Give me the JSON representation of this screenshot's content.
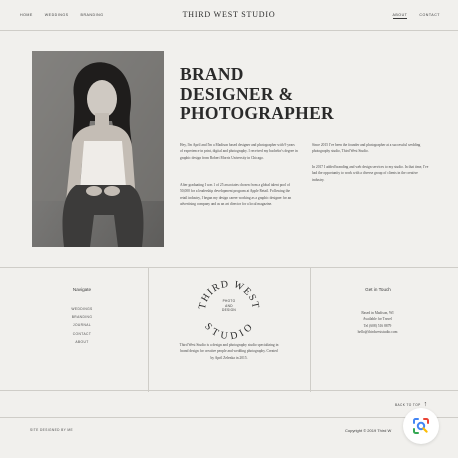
{
  "nav": {
    "left": [
      {
        "label": "Home"
      },
      {
        "label": "Weddings"
      },
      {
        "label": "Branding"
      }
    ],
    "brand": "THIRD WEST STUDIO",
    "right": [
      {
        "label": "About",
        "active": true
      },
      {
        "label": "Contact"
      }
    ]
  },
  "hero": {
    "title_lines": [
      "BRAND",
      "DESIGNER &",
      "PHOTOGRAPHER"
    ],
    "paragraphs": [
      "Hey, I'm April and I'm a Madison based designer and photographer with 9 years of experience in print, digital and photography. I received my bachelor's degree in graphic design from Robert Morris University in Chicago.",
      "After graduating I was 1 of 25 associates chosen from a global talent pool of 50,000 for a leadership development program at Apple Retail. Following the retail industry, I began my design career working as a graphic designer for an advertising company and as an art director for a local magazine.",
      "Since 2015 I've been the founder and photographer at a successful wedding photography studio, Third West Studio.",
      "In 2017 I added branding and web design services to my studio. In that time, I've had the opportunity to work with a diverse group of clients in the creative industry."
    ]
  },
  "footer": {
    "navigate": {
      "heading": "Navigate",
      "items": [
        "Weddings",
        "Branding",
        "Journal",
        "Contact",
        "About"
      ]
    },
    "seal": {
      "top_text": "THIRD WEST",
      "bottom_text": "STUDIO",
      "center_lines": [
        "Photo",
        "and",
        "Design"
      ]
    },
    "about": "Third West Studio is a design and photography studio specializing in brand design for creative people and wedding photography. Created by April Zelenka in 2015.",
    "contact": {
      "heading": "Get in Touch",
      "lines": [
        "Based in Madison, WI",
        "Available for Travel",
        "Tel (608) 516 8879",
        "hello@thirdweststudio.com"
      ]
    }
  },
  "bottom": {
    "back_to_top": "Back to top",
    "credit": "Site designed by me",
    "copyright": "Copyright © 2019 Third W"
  },
  "icons": {
    "back_to_top": "arrow-up-icon",
    "lens": "google-lens-icon"
  },
  "colors": {
    "background": "#f1f0ed",
    "text": "#2b2b2b",
    "divider": "#cfcdc8",
    "lens_blue": "#4285f4"
  }
}
